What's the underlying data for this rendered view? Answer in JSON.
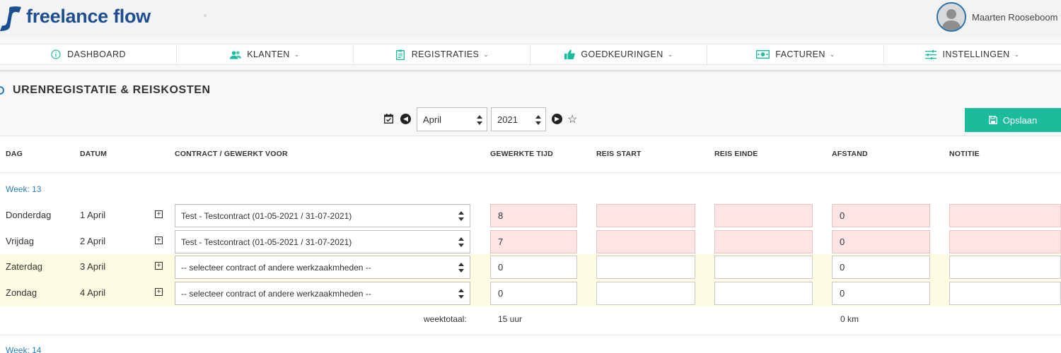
{
  "brand": {
    "name": "freelance flow",
    "color": "#1d4e8f"
  },
  "user": {
    "name": "Maarten Rooseboom"
  },
  "nav": [
    {
      "label": "DASHBOARD",
      "icon": "info-icon",
      "caret": false
    },
    {
      "label": "KLANTEN",
      "icon": "users-icon",
      "caret": true
    },
    {
      "label": "REGISTRATIES",
      "icon": "clipboard-icon",
      "caret": true
    },
    {
      "label": "GOEDKEURINGEN",
      "icon": "thumbs-up-icon",
      "caret": true
    },
    {
      "label": "FACTUREN",
      "icon": "money-icon",
      "caret": true
    },
    {
      "label": "INSTELLINGEN",
      "icon": "sliders-icon",
      "caret": true
    }
  ],
  "page_title": "URENREGISTATIE & REISKOSTEN",
  "controls": {
    "month": "April",
    "year": "2021",
    "save_label": "Opslaan"
  },
  "accent_color": "#1abc9c",
  "columns": [
    "DAG",
    "DATUM",
    "CONTRACT / GEWERKT VOOR",
    "GEWERKTE TIJD",
    "REIS START",
    "REIS EINDE",
    "AFSTAND",
    "NOTITIE"
  ],
  "weeks": [
    {
      "label": "Week: 13",
      "rows": [
        {
          "day": "Donderdag",
          "date": "1 April",
          "contract": "Test - Testcontract (01-05-2021 / 31-07-2021)",
          "hours": "8",
          "reis_start": "",
          "reis_einde": "",
          "afstand": "0",
          "notitie": "",
          "weekend": false,
          "error": true
        },
        {
          "day": "Vrijdag",
          "date": "2 April",
          "contract": "Test - Testcontract (01-05-2021 / 31-07-2021)",
          "hours": "7",
          "reis_start": "",
          "reis_einde": "",
          "afstand": "0",
          "notitie": "",
          "weekend": false,
          "error": true
        },
        {
          "day": "Zaterdag",
          "date": "3 April",
          "contract": "-- selecteer contract of andere werkzaakmheden --",
          "hours": "0",
          "reis_start": "",
          "reis_einde": "",
          "afstand": "0",
          "notitie": "",
          "weekend": true,
          "error": false
        },
        {
          "day": "Zondag",
          "date": "4 April",
          "contract": "-- selecteer contract of andere werkzaakmheden --",
          "hours": "0",
          "reis_start": "",
          "reis_einde": "",
          "afstand": "0",
          "notitie": "",
          "weekend": true,
          "error": false
        }
      ],
      "total_label": "weektotaal:",
      "total_hours": "15 uur",
      "total_km": "0 km"
    },
    {
      "label": "Week: 14"
    }
  ]
}
